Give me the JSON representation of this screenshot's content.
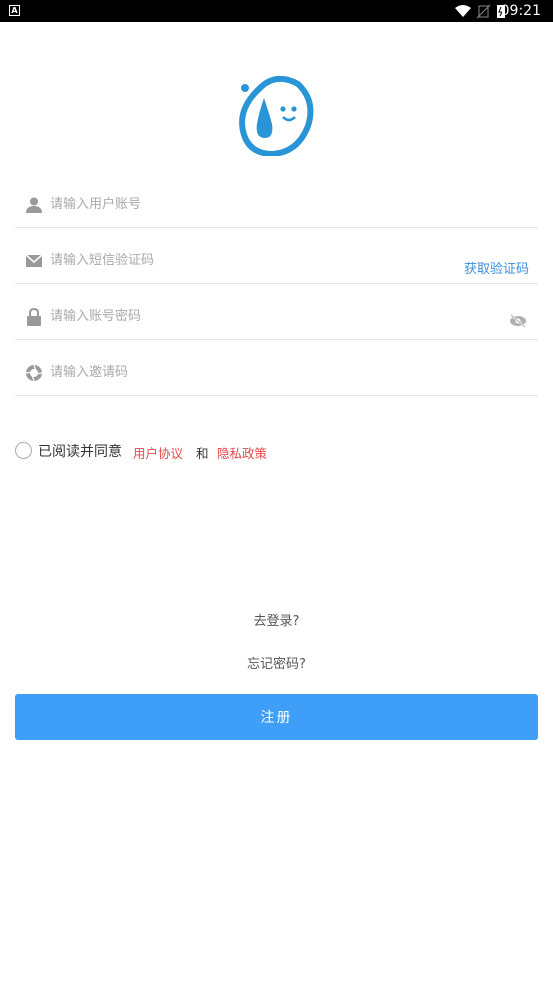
{
  "status": {
    "time": "09:21",
    "indicator": "A"
  },
  "form": {
    "username": {
      "placeholder": "请输入用户账号",
      "icon": "user-icon"
    },
    "sms": {
      "placeholder": "请输入短信验证码",
      "icon": "mail-icon",
      "action": "获取验证码"
    },
    "password": {
      "placeholder": "请输入账号密码",
      "icon": "lock-icon"
    },
    "invite": {
      "placeholder": "请输入邀请码",
      "icon": "aperture-icon"
    }
  },
  "agreement": {
    "prefix": "已阅读并同意",
    "terms": "用户协议",
    "and": "和",
    "privacy": "隐私政策"
  },
  "links": {
    "login": "去登录?",
    "forgot": "忘记密码?"
  },
  "submit": {
    "label": "注册"
  },
  "colors": {
    "accent": "#3f9ef8",
    "logo": "#2a95d6",
    "link": "#3d8fe0",
    "warn": "#e24c4c"
  }
}
